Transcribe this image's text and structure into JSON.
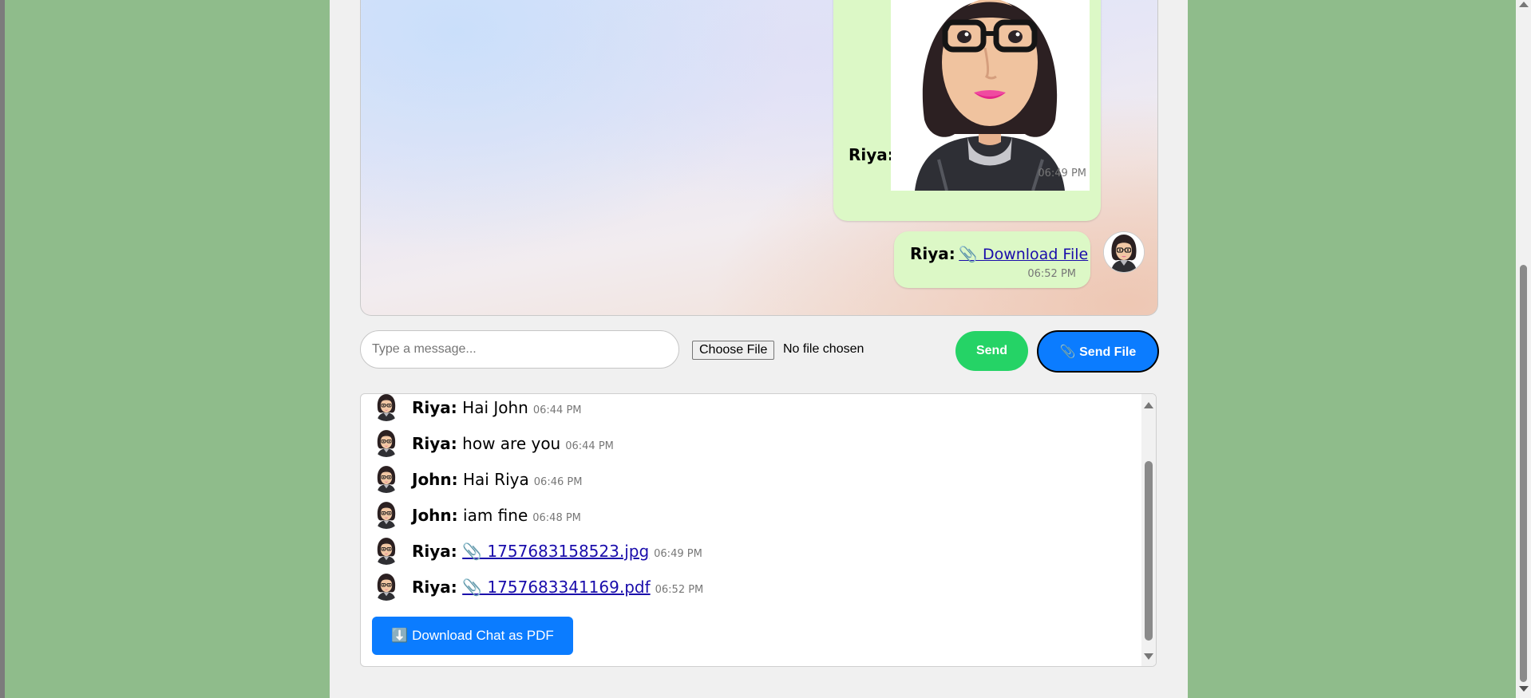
{
  "chat": {
    "image_message": {
      "sender": "Riya:",
      "time": "06:49 PM"
    },
    "file_message": {
      "sender": "Riya:",
      "link": "📎 Download File",
      "time": "06:52 PM"
    }
  },
  "composer": {
    "placeholder": "Type a message...",
    "choose_file": "Choose File",
    "file_status": "No file chosen",
    "send": "Send",
    "send_file": "📎 Send File"
  },
  "history": {
    "messages": [
      {
        "sender": "Riya:",
        "text": "Hai John",
        "time": "06:44 PM"
      },
      {
        "sender": "Riya:",
        "text": "how are you",
        "time": "06:44 PM"
      },
      {
        "sender": "John:",
        "text": "Hai Riya",
        "time": "06:46 PM"
      },
      {
        "sender": "John:",
        "text": "iam fine",
        "time": "06:48 PM"
      },
      {
        "sender": "Riya:",
        "link": "📎 1757683158523.jpg",
        "time": "06:49 PM"
      },
      {
        "sender": "Riya:",
        "link": "📎 1757683341169.pdf",
        "time": "06:52 PM"
      }
    ],
    "download_pdf": "⬇️ Download Chat as PDF"
  },
  "colors": {
    "page_bg": "#8fbc8b",
    "bubble_bg": "#dcf8c6",
    "send_btn": "#25d366",
    "send_file_btn": "#0b7cff",
    "link": "#1a0dab"
  }
}
